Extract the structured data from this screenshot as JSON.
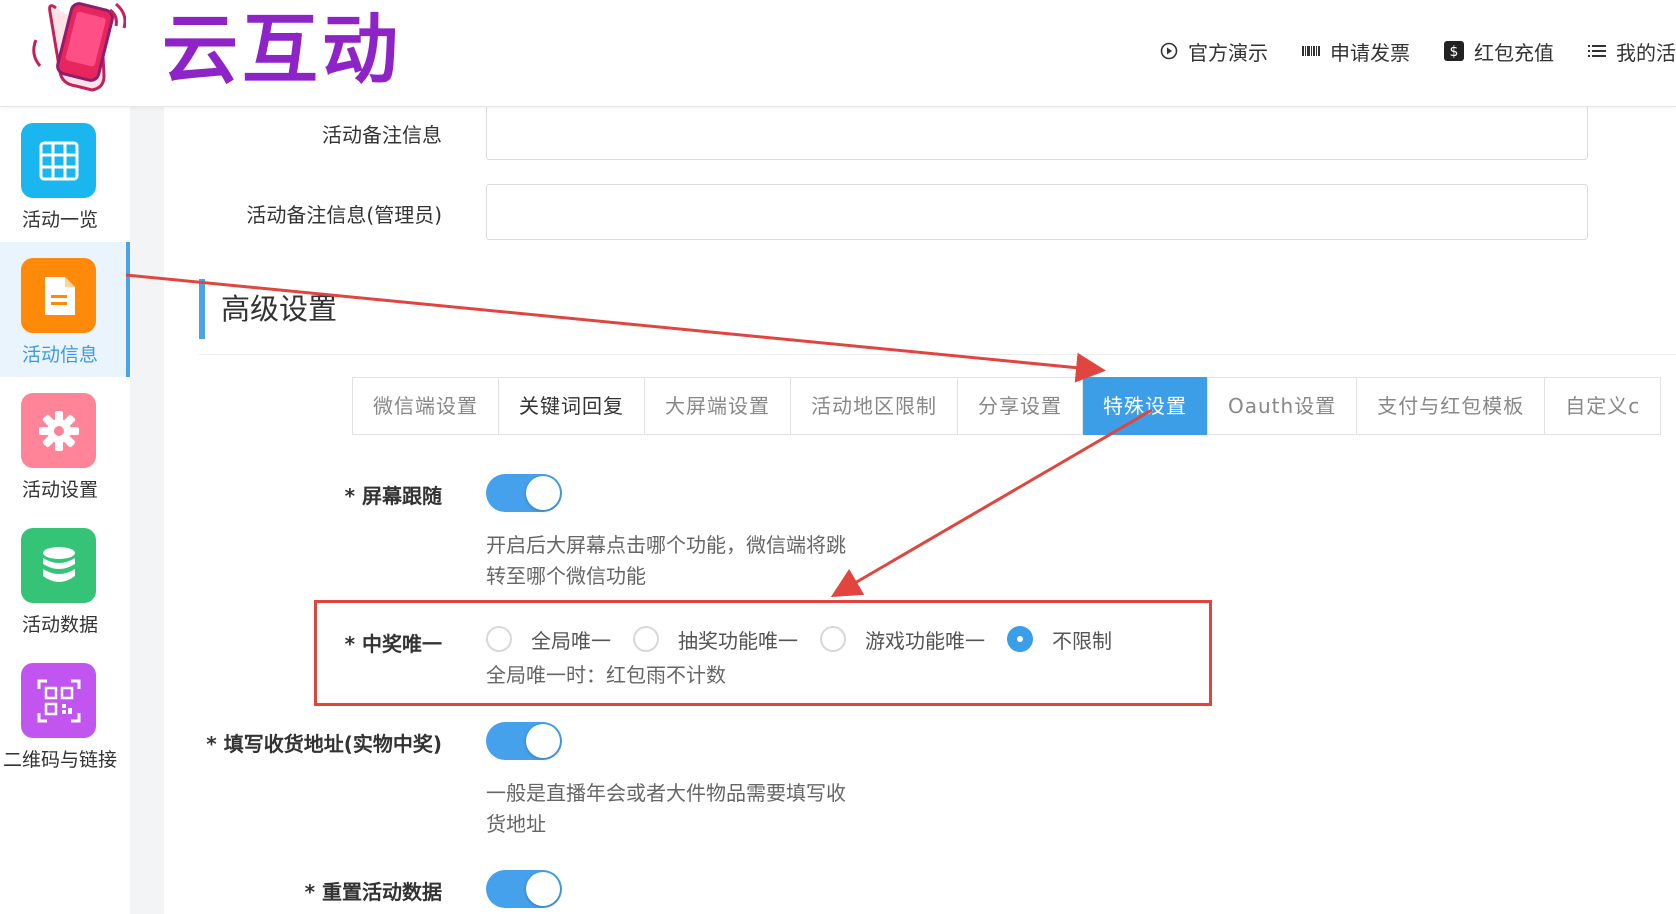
{
  "header": {
    "logo_text": "云互动",
    "nav": [
      {
        "label": "官方演示",
        "icon": "play-circle-icon"
      },
      {
        "label": "申请发票",
        "icon": "barcode-icon"
      },
      {
        "label": "红包充值",
        "icon": "dollar-icon"
      },
      {
        "label": "我的活",
        "icon": "list-icon"
      }
    ]
  },
  "sidebar": {
    "items": [
      {
        "label": "活动一览",
        "icon": "grid-icon",
        "color": "#1ab6f0"
      },
      {
        "label": "活动信息",
        "icon": "document-icon",
        "color": "#ff8a0a"
      },
      {
        "label": "活动设置",
        "icon": "gear-icon",
        "color": "#ff8497"
      },
      {
        "label": "活动数据",
        "icon": "database-icon",
        "color": "#35c477"
      },
      {
        "label": "二维码与链接",
        "icon": "qrcode-icon",
        "color": "#c254f0"
      }
    ]
  },
  "form": {
    "remark_label": "活动备注信息",
    "remark_admin_label": "活动备注信息(管理员)"
  },
  "section": {
    "title": "高级设置"
  },
  "tabs": [
    {
      "label": "微信端设置"
    },
    {
      "label": "关键词回复"
    },
    {
      "label": "大屏端设置"
    },
    {
      "label": "活动地区限制"
    },
    {
      "label": "分享设置"
    },
    {
      "label": "特殊设置"
    },
    {
      "label": "Oauth设置"
    },
    {
      "label": "支付与红包模板"
    },
    {
      "label": "自定义c"
    }
  ],
  "settings": {
    "screen_follow": {
      "label": "* 屏幕跟随",
      "enabled": true,
      "help_line1": "开启后大屏幕点击哪个功能，微信端将跳",
      "help_line2": "转至哪个微信功能"
    },
    "unique_win": {
      "label": "* 中奖唯一",
      "options": [
        "全局唯一",
        "抽奖功能唯一",
        "游戏功能唯一",
        "不限制"
      ],
      "selected": "不限制",
      "help": "全局唯一时：红包雨不计数"
    },
    "address": {
      "label": "* 填写收货地址(实物中奖)",
      "enabled": true,
      "help_line1": "一般是直播年会或者大件物品需要填写收",
      "help_line2": "货地址"
    },
    "reset": {
      "label": "* 重置活动数据",
      "enabled": true
    }
  },
  "colors": {
    "accent": "#3d9ee8",
    "annotation": "#e0453f"
  }
}
